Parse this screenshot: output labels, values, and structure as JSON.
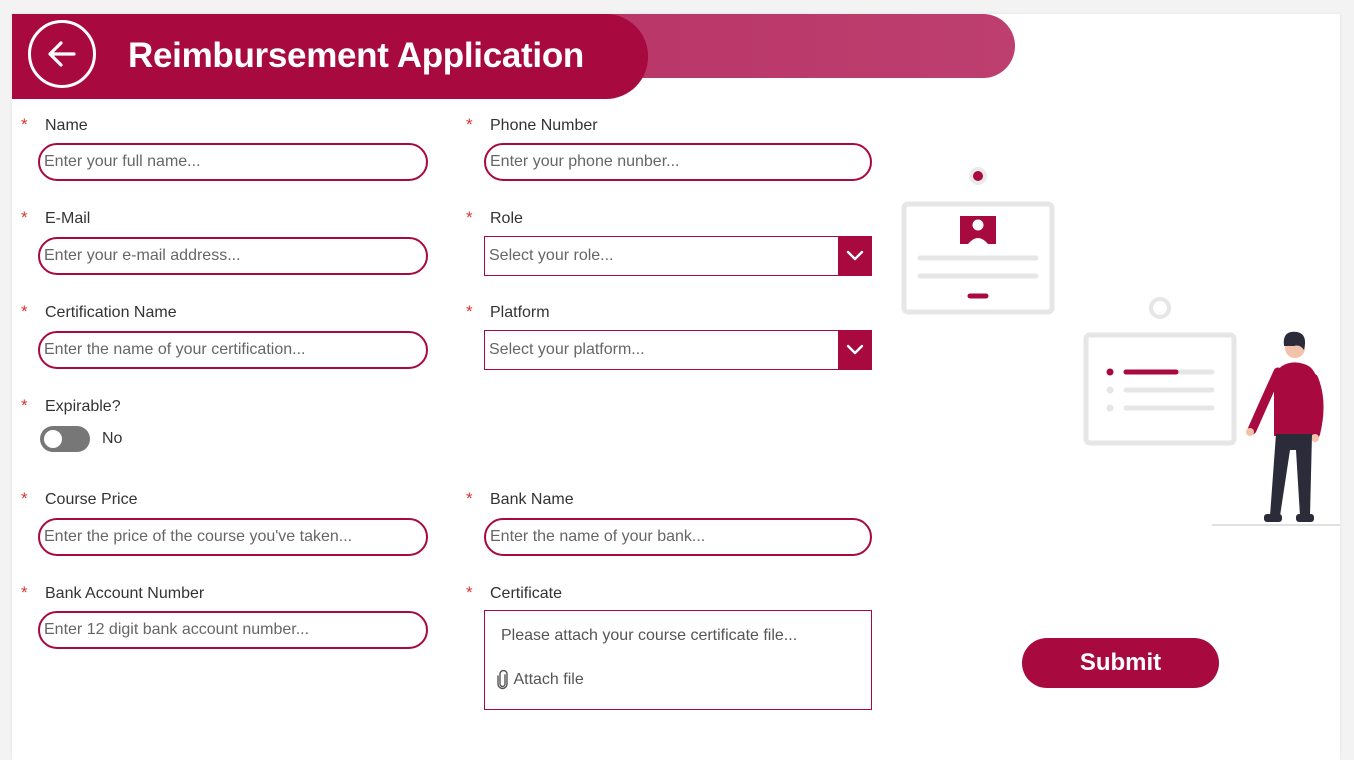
{
  "header": {
    "title": "Reimbursement Application",
    "back_icon": "arrow-left-icon"
  },
  "colors": {
    "accent": "#a8093f",
    "accent_light": "#bd3f6f",
    "required": "#dd3333"
  },
  "form": {
    "required_marker": "*",
    "name": {
      "label": "Name",
      "placeholder": "Enter your full name..."
    },
    "phone": {
      "label": "Phone Number",
      "placeholder": "Enter your phone nunber..."
    },
    "email": {
      "label": "E-Mail",
      "placeholder": "Enter your e-mail address..."
    },
    "role": {
      "label": "Role",
      "placeholder": "Select your role..."
    },
    "cert_name": {
      "label": "Certification Name",
      "placeholder": "Enter the name of your certification..."
    },
    "platform": {
      "label": "Platform",
      "placeholder": "Select your platform..."
    },
    "expirable": {
      "label": "Expirable?",
      "value_label": "No",
      "checked": false
    },
    "course_price": {
      "label": "Course Price",
      "placeholder": "Enter the price of the course you've taken..."
    },
    "bank_name": {
      "label": "Bank Name",
      "placeholder": "Enter the name of your bank..."
    },
    "bank_account": {
      "label": "Bank Account Number",
      "placeholder": "Enter 12 digit bank account number..."
    },
    "certificate": {
      "label": "Certificate",
      "hint": "Please attach your course certificate file...",
      "attach_label": "Attach file",
      "attach_icon": "paperclip-icon"
    }
  },
  "submit_label": "Submit"
}
